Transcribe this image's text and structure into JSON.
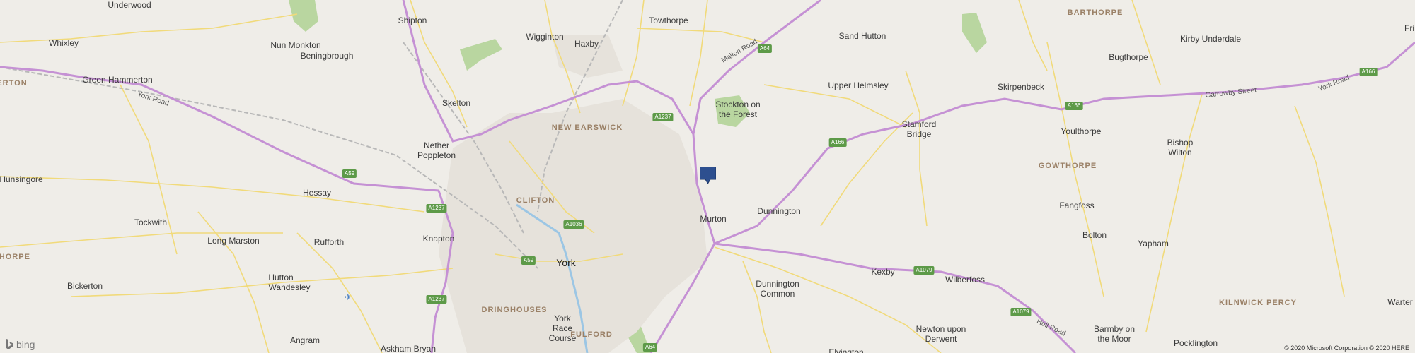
{
  "map": {
    "colors": {
      "land": "#efede8",
      "major_road": "#c591d4",
      "minor_road": "#f1da7a",
      "rail": "#b8b8b8",
      "green": "#b9d6a0",
      "urban": "#e6e2db",
      "pin": "#2d4f8f",
      "road_shield": "#5d9a48"
    },
    "places": [
      {
        "name": "Underwood",
        "type": "town"
      },
      {
        "name": "Shipton",
        "type": "town"
      },
      {
        "name": "Towthorpe",
        "type": "town"
      },
      {
        "name": "Sand Hutton",
        "type": "town"
      },
      {
        "name": "BARTHORPE",
        "type": "district"
      },
      {
        "name": "Whixley",
        "type": "town"
      },
      {
        "name": "Nun Monkton",
        "type": "town"
      },
      {
        "name": "Wigginton",
        "type": "town"
      },
      {
        "name": "Haxby",
        "type": "town"
      },
      {
        "name": "Kirby Underdale",
        "type": "town"
      },
      {
        "name": "Beningbrough",
        "type": "town"
      },
      {
        "name": "Bugthorpe",
        "type": "town"
      },
      {
        "name": "ERTON",
        "type": "district"
      },
      {
        "name": "Green Hammerton",
        "type": "town"
      },
      {
        "name": "Upper Helmsley",
        "type": "town"
      },
      {
        "name": "Skirpenbeck",
        "type": "town"
      },
      {
        "name": "Skelton",
        "type": "town"
      },
      {
        "name": "Stockton on",
        "type": "town"
      },
      {
        "name": "the Forest",
        "type": "town"
      },
      {
        "name": "NEW EARSWICK",
        "type": "district"
      },
      {
        "name": "Stamford",
        "type": "town"
      },
      {
        "name": "Bridge",
        "type": "town"
      },
      {
        "name": "Youlthorpe",
        "type": "town"
      },
      {
        "name": "Nether",
        "type": "town"
      },
      {
        "name": "Poppleton",
        "type": "town"
      },
      {
        "name": "Bishop",
        "type": "town"
      },
      {
        "name": "Wilton",
        "type": "town"
      },
      {
        "name": "GOWTHORPE",
        "type": "district"
      },
      {
        "name": "Hunsingore",
        "type": "town"
      },
      {
        "name": "Hessay",
        "type": "town"
      },
      {
        "name": "CLIFTON",
        "type": "district"
      },
      {
        "name": "Fangfoss",
        "type": "town"
      },
      {
        "name": "Dunnington",
        "type": "town"
      },
      {
        "name": "Tockwith",
        "type": "town"
      },
      {
        "name": "Murton",
        "type": "town"
      },
      {
        "name": "Knapton",
        "type": "town"
      },
      {
        "name": "Long Marston",
        "type": "town"
      },
      {
        "name": "Rufforth",
        "type": "town"
      },
      {
        "name": "Bolton",
        "type": "town"
      },
      {
        "name": "Yapham",
        "type": "town"
      },
      {
        "name": "THORPE",
        "type": "district"
      },
      {
        "name": "York",
        "type": "city"
      },
      {
        "name": "Hutton",
        "type": "town"
      },
      {
        "name": "Wandesley",
        "type": "town"
      },
      {
        "name": "Kexby",
        "type": "town"
      },
      {
        "name": "Wilberfoss",
        "type": "town"
      },
      {
        "name": "Dunnington",
        "type": "town"
      },
      {
        "name": "Common",
        "type": "town"
      },
      {
        "name": "Bickerton",
        "type": "town"
      },
      {
        "name": "KILNWICK PERCY",
        "type": "district"
      },
      {
        "name": "Warter",
        "type": "town"
      },
      {
        "name": "DRINGHOUSES",
        "type": "district"
      },
      {
        "name": "York",
        "type": "town"
      },
      {
        "name": "Race",
        "type": "town"
      },
      {
        "name": "Course",
        "type": "town"
      },
      {
        "name": "Newton upon",
        "type": "town"
      },
      {
        "name": "Derwent",
        "type": "town"
      },
      {
        "name": "Barmby on",
        "type": "town"
      },
      {
        "name": "the Moor",
        "type": "town"
      },
      {
        "name": "Angram",
        "type": "town"
      },
      {
        "name": "Askham Bryan",
        "type": "town"
      },
      {
        "name": "FULFORD",
        "type": "district"
      },
      {
        "name": "Pocklington",
        "type": "town"
      },
      {
        "name": "Elvington",
        "type": "town"
      },
      {
        "name": "Fri",
        "type": "town"
      }
    ],
    "road_shields": [
      "A64",
      "A1237",
      "A166",
      "A166",
      "A166",
      "A59",
      "A1237",
      "A1036",
      "A59",
      "A1237",
      "A1079",
      "A1079",
      "A64"
    ],
    "road_names": [
      "Malton Road",
      "York Road",
      "Garrowby Street",
      "York Road",
      "Hull Road"
    ],
    "pin_icon": "location-marker-icon",
    "airport_icon": "airport-icon",
    "logo_text": "bing",
    "attribution": "© 2020 Microsoft Corporation © 2020 HERE"
  }
}
